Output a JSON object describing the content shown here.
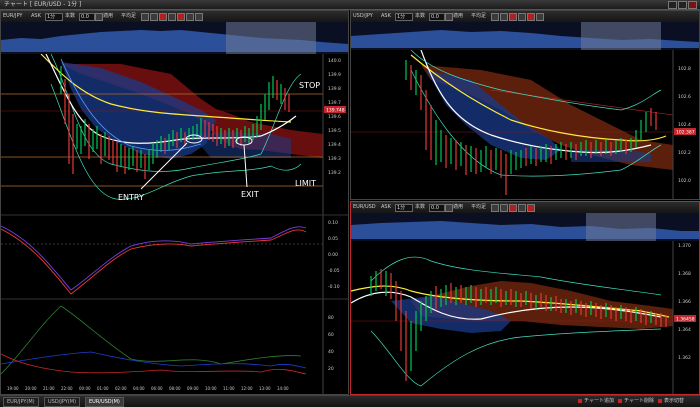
{
  "window": {
    "title": "チャート [ EUR/USD - 1分 ]"
  },
  "toolbar": {
    "ask_label": "ASK",
    "interval_label": "本数",
    "average_label": "平均足",
    "apply_label": "適用"
  },
  "panes": [
    {
      "pair": "EUR/JPY",
      "interval": "1分",
      "count": "0.0",
      "price_ticks": [
        "140.0",
        "139.9",
        "139.8",
        "139.7",
        "139.6",
        "139.5",
        "139.4",
        "139.3",
        "139.2"
      ],
      "current_price": "139.748",
      "sub1_ticks": [
        "0.10",
        "0.05",
        "0.00",
        "-0.05",
        "-0.10"
      ],
      "sub2_ticks": [
        "80",
        "60",
        "40",
        "20"
      ],
      "time_labels": [
        "19:00",
        "20:00",
        "21:00",
        "22:00",
        "00:00",
        "01:00",
        "02:00",
        "04:00",
        "06:00",
        "08:00",
        "09:00",
        "10:00",
        "11:00",
        "12:00",
        "13:00",
        "14:00"
      ]
    },
    {
      "pair": "USD/JPY",
      "interval": "1分",
      "count": "0.0",
      "price_ticks": [
        "102.8",
        "102.6",
        "102.4",
        "102.2",
        "102.0"
      ],
      "current_price": "102.387"
    },
    {
      "pair": "EUR/USD",
      "interval": "1分",
      "count": "0.0",
      "price_ticks": [
        "1.370",
        "1.368",
        "1.366",
        "1.364",
        "1.362"
      ],
      "current_price": "1.36458"
    }
  ],
  "annotations": {
    "stop": "STOP",
    "entry": "ENTRY",
    "exit": "EXIT",
    "limit": "LIMIT"
  },
  "tabs": [
    "EUR/JPY(M)",
    "USD/JPY(M)",
    "EUR/USD(M)"
  ],
  "bottom_buttons": [
    "チャート追加",
    "チャート削除",
    "表示切替"
  ],
  "colors": {
    "buy": "#00c853",
    "sell": "#e53935",
    "cloud_red": "#7a1010",
    "cloud_blue": "#1a3a8a",
    "ma_yellow": "#ffeb3b",
    "active_border": "#c1272d"
  }
}
